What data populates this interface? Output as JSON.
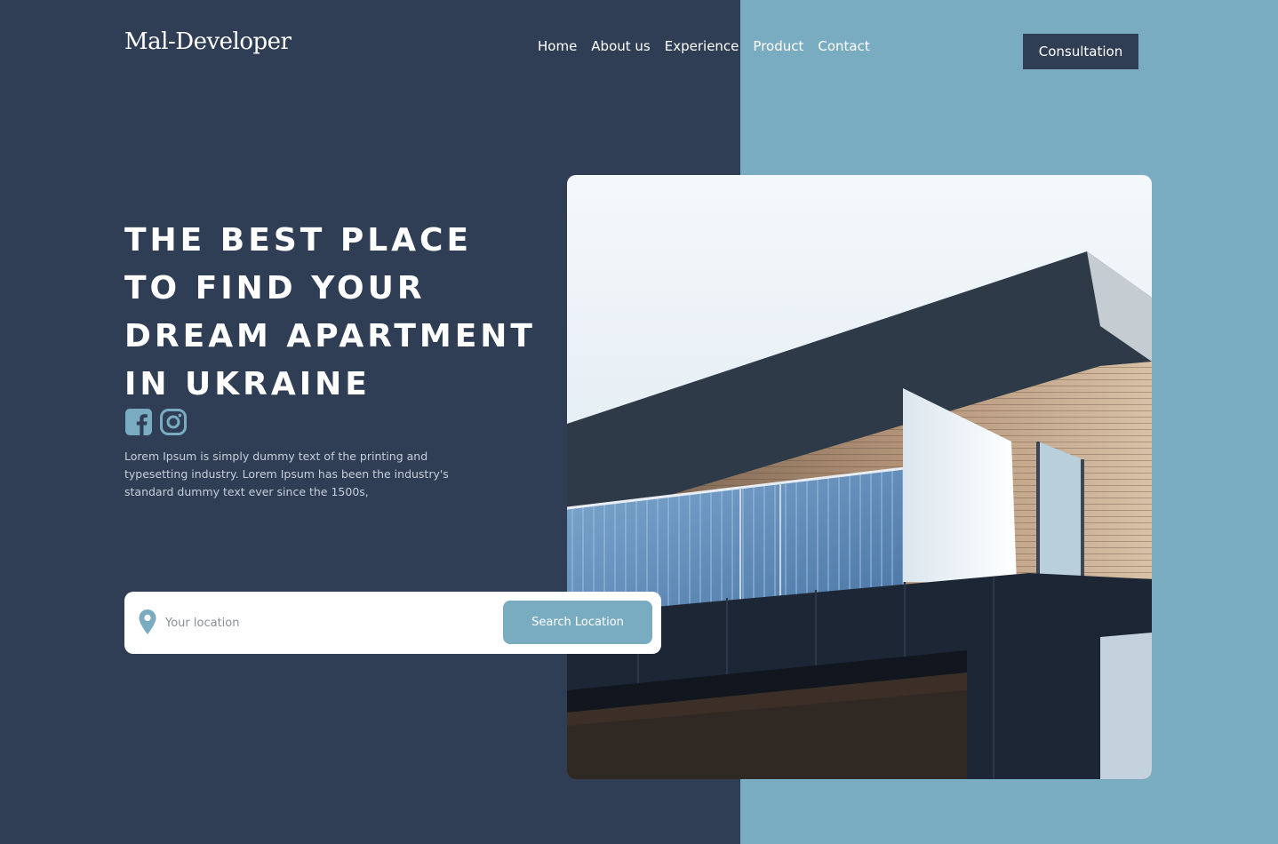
{
  "brand": {
    "logo_text": "Mal-Developer"
  },
  "nav": {
    "items": [
      {
        "label": "Home"
      },
      {
        "label": "About us"
      },
      {
        "label": "Experience"
      },
      {
        "label": "Product"
      },
      {
        "label": "Contact"
      }
    ]
  },
  "header": {
    "cta_label": "Consultation"
  },
  "hero": {
    "headline_lines": [
      "THE BEST PLACE",
      "TO FIND YOUR",
      "DREAM APARTMENT",
      "IN UKRAINE"
    ],
    "description": "Lorem Ipsum is simply dummy text of the printing and typesetting industry. Lorem Ipsum has been the industry's standard dummy text ever since the 1500s,",
    "image_subject": "modern-apartment-building-photo"
  },
  "social": {
    "icons": [
      "facebook-icon",
      "instagram-icon"
    ]
  },
  "search": {
    "placeholder": "Your location",
    "value": "",
    "button_label": "Search Location",
    "icon": "location-pin-icon"
  },
  "colors": {
    "dark_navy": "#2f3e54",
    "accent_blue": "#7aacc1",
    "white": "#ffffff"
  }
}
